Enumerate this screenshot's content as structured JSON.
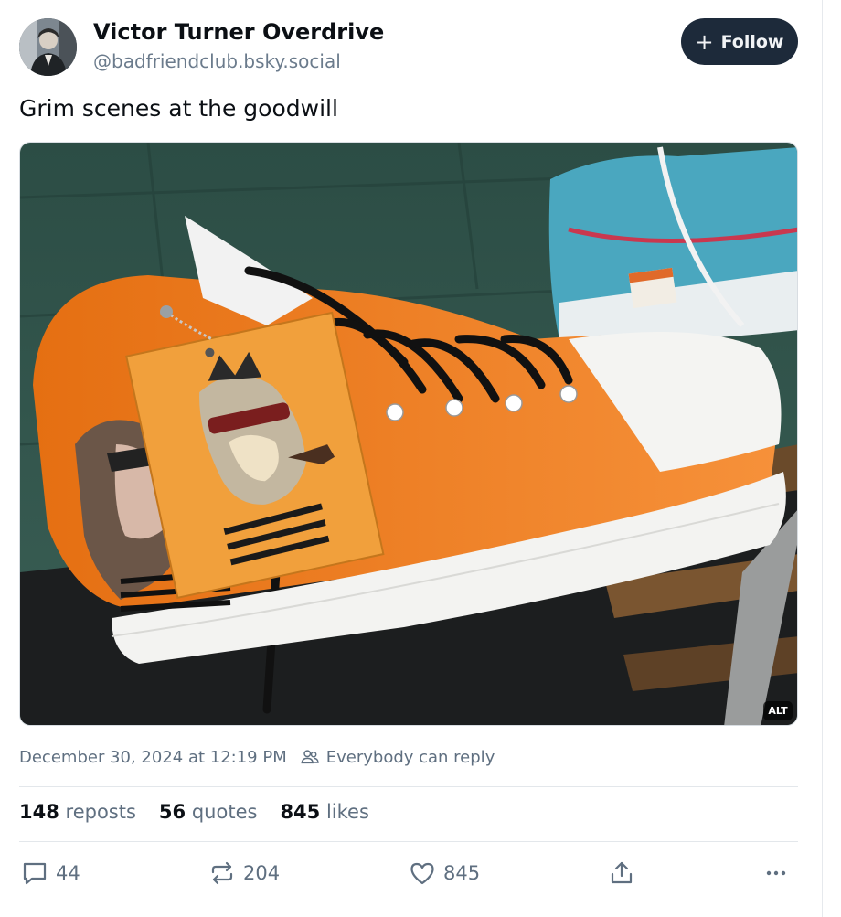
{
  "author": {
    "display_name": "Victor Turner Overdrive",
    "handle": "@badfriendclub.bsky.social"
  },
  "follow_button": {
    "label": "Follow",
    "icon": "plus-icon"
  },
  "post": {
    "text": "Grim scenes at the goodwill",
    "image_alt_badge": "ALT",
    "timestamp": "December 30, 2024 at 12:19 PM",
    "reply_setting": "Everybody can reply"
  },
  "stats": {
    "reposts": {
      "count": "148",
      "label": "reposts"
    },
    "quotes": {
      "count": "56",
      "label": "quotes"
    },
    "likes": {
      "count": "845",
      "label": "likes"
    }
  },
  "actions": {
    "reply": {
      "icon": "comment-icon",
      "count": "44"
    },
    "repost": {
      "icon": "repost-icon",
      "count": "204"
    },
    "like": {
      "icon": "heart-icon",
      "count": "845"
    },
    "share": {
      "icon": "share-icon"
    },
    "more": {
      "icon": "more-dots-icon"
    }
  },
  "colors": {
    "follow_bg": "#1d2a3a",
    "muted_text": "#5f6f80",
    "shoe_orange": "#f07a1a"
  }
}
